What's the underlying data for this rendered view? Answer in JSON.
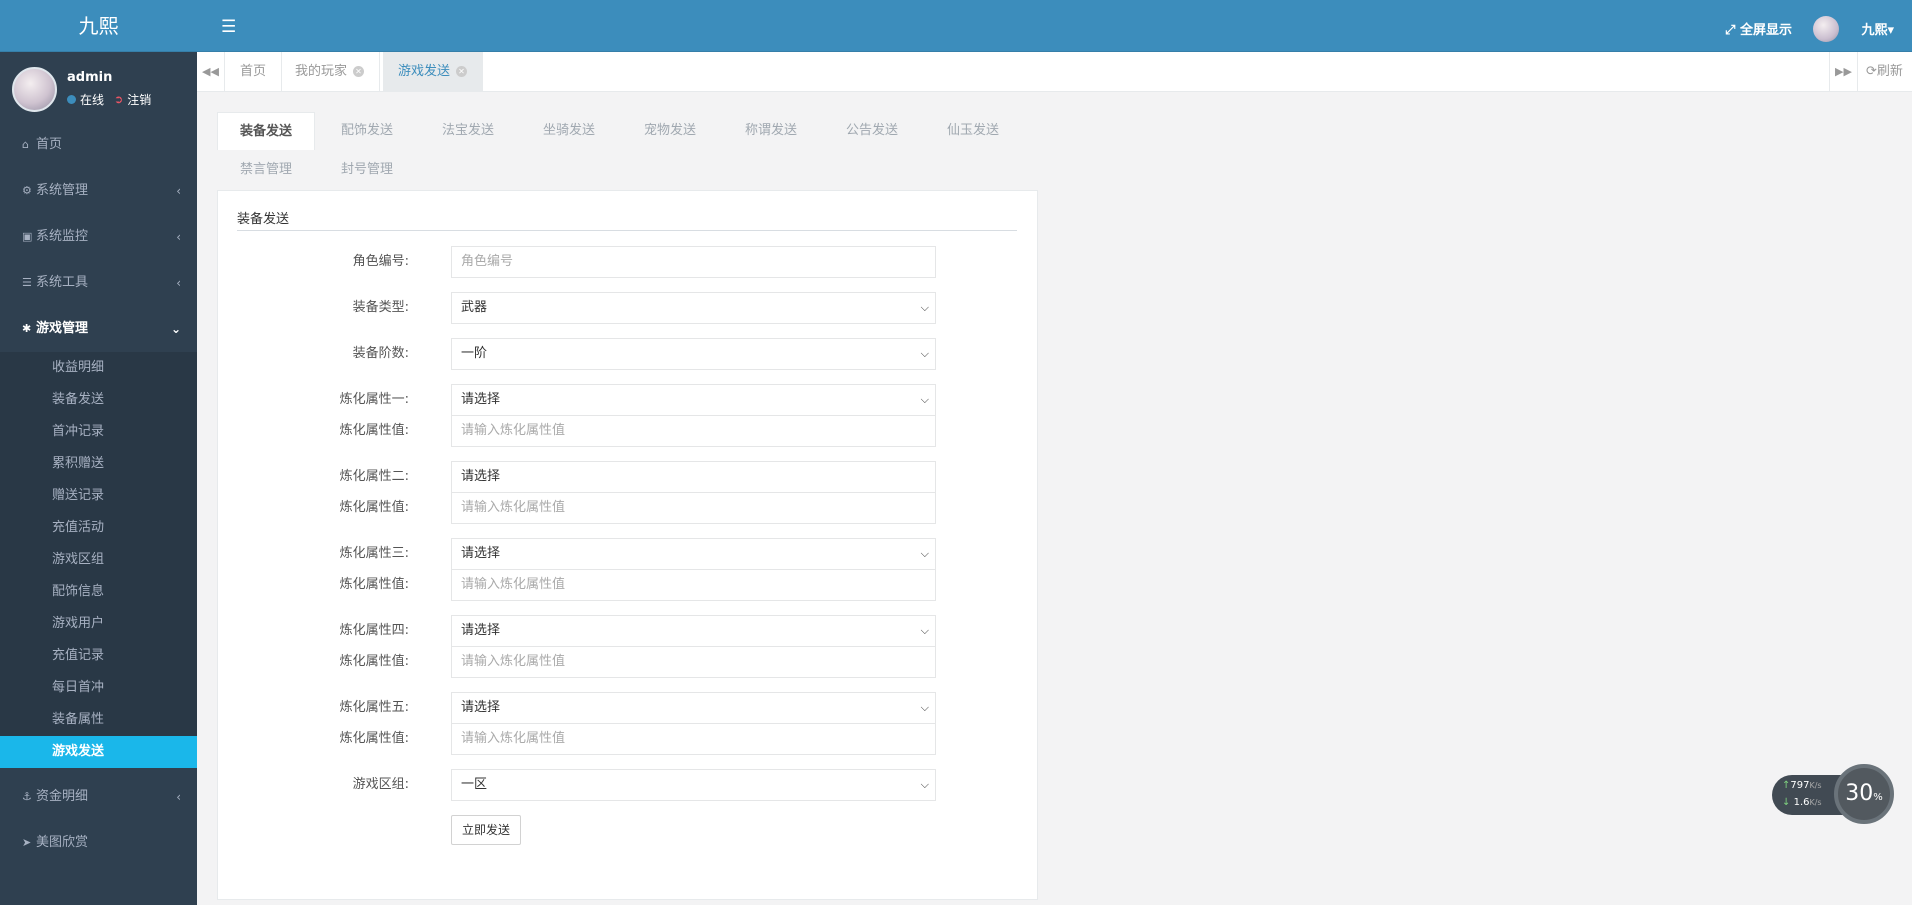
{
  "app": {
    "logo": "九熙"
  },
  "user": {
    "name": "admin",
    "status": "在线",
    "logout": "注销"
  },
  "sidebar": {
    "items": [
      {
        "label": "首页",
        "icon": "home-icon"
      },
      {
        "label": "系统管理",
        "icon": "gear-icon"
      },
      {
        "label": "系统监控",
        "icon": "video-icon"
      },
      {
        "label": "系统工具",
        "icon": "bars-icon"
      },
      {
        "label": "游戏管理",
        "icon": "asterisk-icon"
      }
    ],
    "game_submenu": [
      "收益明细",
      "装备发送",
      "首冲记录",
      "累积赠送",
      "赠送记录",
      "充值活动",
      "游戏区组",
      "配饰信息",
      "游戏用户",
      "充值记录",
      "每日首冲",
      "装备属性",
      "游戏发送"
    ],
    "bottom_items": [
      {
        "label": "资金明细",
        "icon": "anchor-icon"
      },
      {
        "label": "美图欣赏",
        "icon": "paper-plane-icon"
      }
    ]
  },
  "topbar": {
    "fullscreen": "全屏显示",
    "username": "九熙"
  },
  "page_tabs": [
    {
      "label": "首页"
    },
    {
      "label": "我的玩家"
    },
    {
      "label": "游戏发送"
    }
  ],
  "refresh_label": "刷新",
  "content_tabs": [
    "装备发送",
    "配饰发送",
    "法宝发送",
    "坐骑发送",
    "宠物发送",
    "称谓发送",
    "公告发送",
    "仙玉发送",
    "禁言管理",
    "封号管理"
  ],
  "form": {
    "title": "装备发送",
    "role_label": "角色编号:",
    "role_placeholder": "角色编号",
    "type_label": "装备类型:",
    "type_value": "武器",
    "level_label": "装备阶数:",
    "level_value": "一阶",
    "attr1_label": "炼化属性一:",
    "attr1_value": "请选择",
    "val_label": "炼化属性值:",
    "val_placeholder": "请输入炼化属性值",
    "attr2_label": "炼化属性二:",
    "attr2_value": "请选择",
    "attr3_label": "炼化属性三:",
    "attr3_value": "请选择",
    "attr4_label": "炼化属性四:",
    "attr4_value": "请选择",
    "attr5_label": "炼化属性五:",
    "attr5_value": "请选择",
    "zone_label": "游戏区组:",
    "zone_value": "一区",
    "submit": "立即发送"
  },
  "speed_widget": {
    "up": "797",
    "up_unit": "K/s",
    "down": "1.6",
    "down_unit": "K/s",
    "percent": "30",
    "percent_sign": "%"
  },
  "colors": {
    "topbar": "#3c8dbc",
    "sidebar": "#2f4050",
    "active_item": "#1ab7ea"
  }
}
